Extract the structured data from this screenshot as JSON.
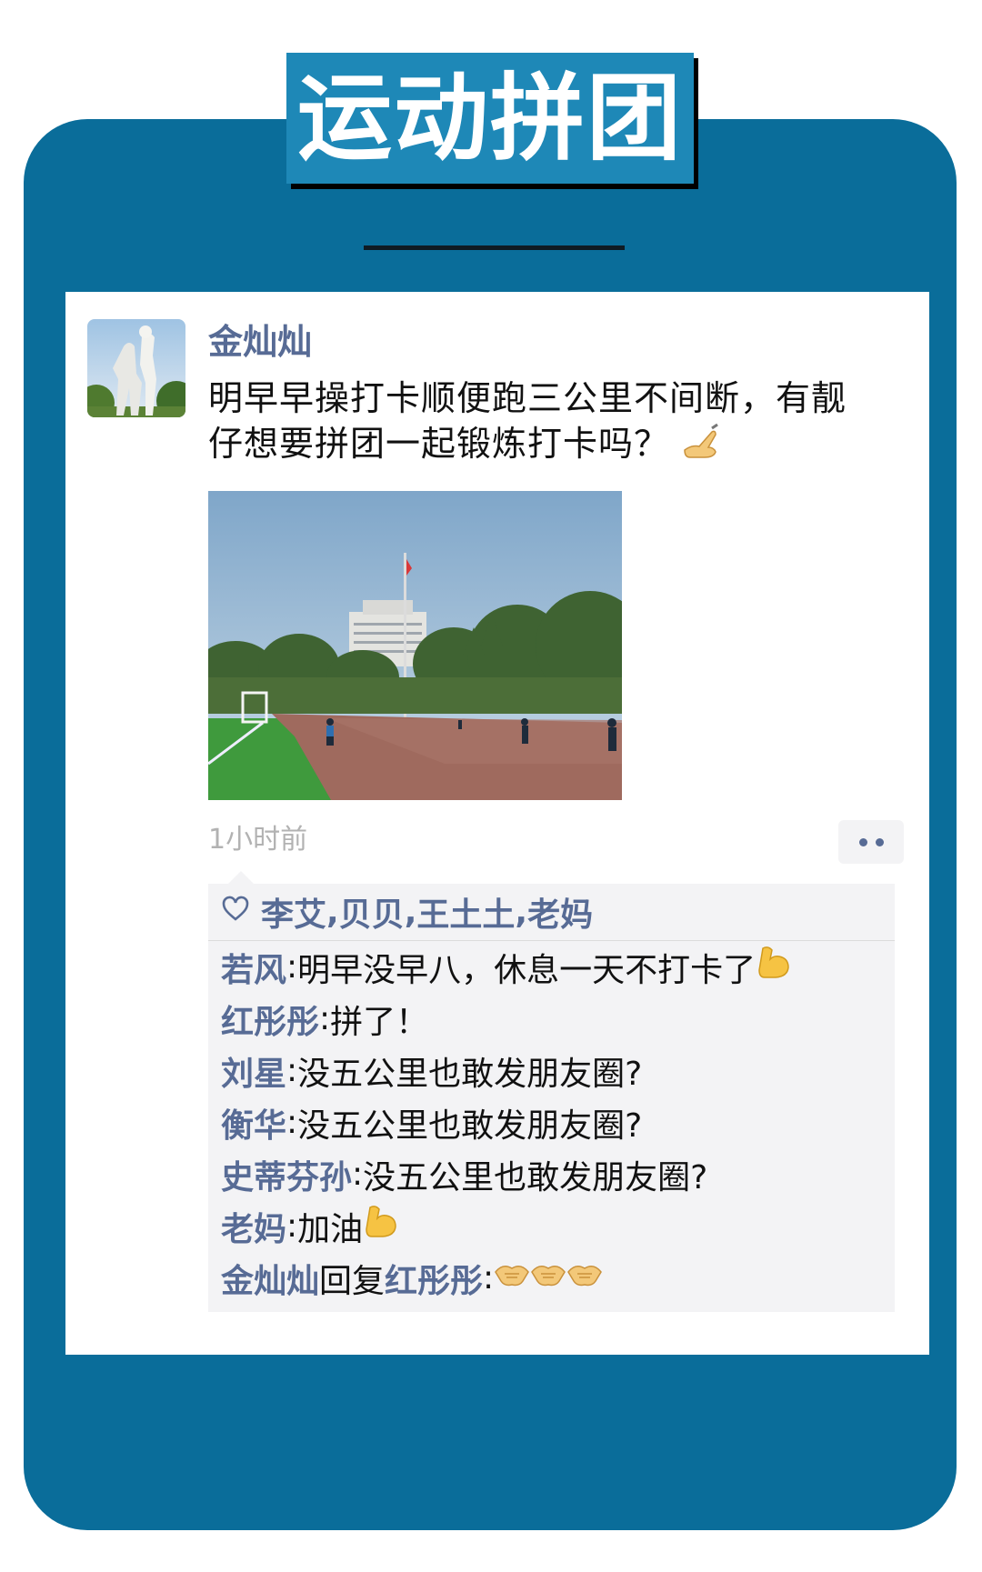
{
  "page_title": "运动拼团",
  "post": {
    "author": "金灿灿",
    "text_line1": "明早早操打卡顺便跑三公里不间断，有靓",
    "text_line2": "仔想要拼团一起锻炼打卡吗？",
    "timestamp": "1小时前"
  },
  "likes": {
    "names": [
      "李艾",
      "贝贝",
      "王土土",
      "老妈"
    ],
    "separator": ","
  },
  "comments": [
    {
      "name": "若风",
      "separator": ": ",
      "text": "明早没早八，休息一天不打卡了",
      "emoji": "muscle"
    },
    {
      "name": "红彤彤",
      "separator": ": ",
      "text": "拼了！"
    },
    {
      "name": "刘星",
      "separator": ": ",
      "text": "没五公里也敢发朋友圈?"
    },
    {
      "name": "衡华",
      "separator": ": ",
      "text": "没五公里也敢发朋友圈?"
    },
    {
      "name": "史蒂芬孙",
      "separator": ": ",
      "text": "没五公里也敢发朋友圈?"
    },
    {
      "name": "老妈",
      "separator": ": ",
      "text": "加油",
      "emoji": "muscle"
    },
    {
      "name": "金灿灿",
      "reply_word": "回复",
      "reply_to": "红彤彤",
      "separator": ": ",
      "emoji": "handshake x3"
    }
  ],
  "icons": {
    "post_emoji": "writing-hand-icon",
    "like": "heart-outline-icon",
    "more": "more-dots-icon"
  },
  "colors": {
    "frame": "#0a6d9a",
    "title_bg": "#1e88b7",
    "name_blue": "#576b95",
    "comment_bg": "#f3f3f5"
  }
}
